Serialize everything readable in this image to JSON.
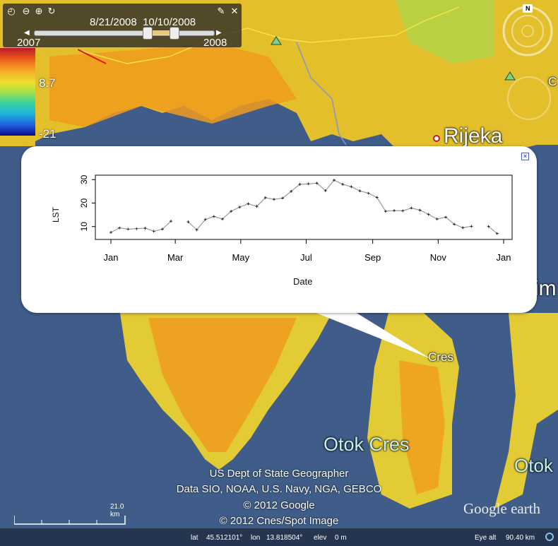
{
  "timebar": {
    "range_label": "8/21/2008  10/10/2008",
    "start_label": "2007",
    "end_label": "2008",
    "icons": [
      "clock-icon",
      "zoom-out-icon",
      "zoom-in-icon",
      "refresh-icon",
      "wrench-icon",
      "close-icon"
    ]
  },
  "colorbar": {
    "mid_label": "8.7",
    "min_label": "-21",
    "colors": [
      "#c0152b",
      "#f26a1b",
      "#f6b42a",
      "#e9e12d",
      "#a9e04a",
      "#3fd39a",
      "#1fb9d8",
      "#1f5fe0",
      "#0b0a8a"
    ]
  },
  "nav": {
    "north_label": "N"
  },
  "places": {
    "rijeka": "Rijeka",
    "cres": "Cres",
    "otok_cres": "Otok Cres",
    "otok_right": "Otok",
    "edge_c": "C",
    "edge_im": "im"
  },
  "popup": {
    "close_label": "×"
  },
  "chart_data": {
    "type": "line",
    "xlabel": "Date",
    "ylabel": "LST",
    "y_ticks": [
      "10",
      "20",
      "30"
    ],
    "x_ticks": [
      "Jan",
      "Mar",
      "May",
      "Jul",
      "Sep",
      "Nov",
      "Jan"
    ],
    "ylim": [
      6,
      31
    ],
    "xlim": [
      "2008-01-01",
      "2009-01-01"
    ],
    "series": [
      {
        "segments": [
          [
            [
              "2008-01-01",
              7.5
            ],
            [
              "2008-01-09",
              9.4
            ],
            [
              "2008-01-17",
              8.9
            ],
            [
              "2008-01-25",
              9.1
            ],
            [
              "2008-02-02",
              9.3
            ],
            [
              "2008-02-10",
              8.0
            ],
            [
              "2008-02-18",
              8.9
            ],
            [
              "2008-02-26",
              12.3
            ]
          ],
          [
            [
              "2008-03-13",
              12.0
            ],
            [
              "2008-03-21",
              8.6
            ],
            [
              "2008-03-29",
              13.0
            ],
            [
              "2008-04-06",
              14.3
            ],
            [
              "2008-04-14",
              13.2
            ],
            [
              "2008-04-22",
              16.5
            ],
            [
              "2008-04-30",
              18.3
            ],
            [
              "2008-05-08",
              19.7
            ],
            [
              "2008-05-16",
              18.6
            ],
            [
              "2008-05-24",
              22.3
            ],
            [
              "2008-06-01",
              21.6
            ],
            [
              "2008-06-09",
              22.1
            ],
            [
              "2008-06-17",
              25.0
            ],
            [
              "2008-06-25",
              28.0
            ],
            [
              "2008-07-03",
              28.2
            ],
            [
              "2008-07-11",
              28.5
            ],
            [
              "2008-07-19",
              25.3
            ],
            [
              "2008-07-27",
              29.8
            ],
            [
              "2008-08-04",
              28.0
            ],
            [
              "2008-08-12",
              27.0
            ],
            [
              "2008-08-20",
              25.2
            ],
            [
              "2008-08-28",
              24.2
            ],
            [
              "2008-09-05",
              22.4
            ],
            [
              "2008-09-13",
              16.5
            ],
            [
              "2008-09-21",
              16.8
            ],
            [
              "2008-09-29",
              16.7
            ],
            [
              "2008-10-07",
              17.9
            ],
            [
              "2008-10-15",
              17.0
            ],
            [
              "2008-10-23",
              15.2
            ],
            [
              "2008-10-31",
              13.2
            ],
            [
              "2008-11-08",
              14.0
            ],
            [
              "2008-11-16",
              11.0
            ],
            [
              "2008-11-24",
              9.5
            ],
            [
              "2008-12-02",
              10.1
            ]
          ],
          [
            [
              "2008-12-18",
              10.0
            ],
            [
              "2008-12-26",
              7.0
            ]
          ]
        ]
      }
    ]
  },
  "attribution": {
    "line1": "US Dept of State Geographer",
    "line2": "Data SIO, NOAA, U.S. Navy, NGA, GEBCO",
    "line3": "© 2012 Google",
    "line4": "© 2012 Cnes/Spot Image"
  },
  "scale": {
    "label": "21.0 km"
  },
  "status": {
    "lat_label": "lat",
    "lat_value": "45.512101°",
    "lon_label": "lon",
    "lon_value": "13.818504°",
    "elev_label": "elev",
    "elev_value": "0 m",
    "eye_label": "Eye alt",
    "eye_value": "90.40 km"
  },
  "brand": {
    "logo": "Google earth"
  }
}
